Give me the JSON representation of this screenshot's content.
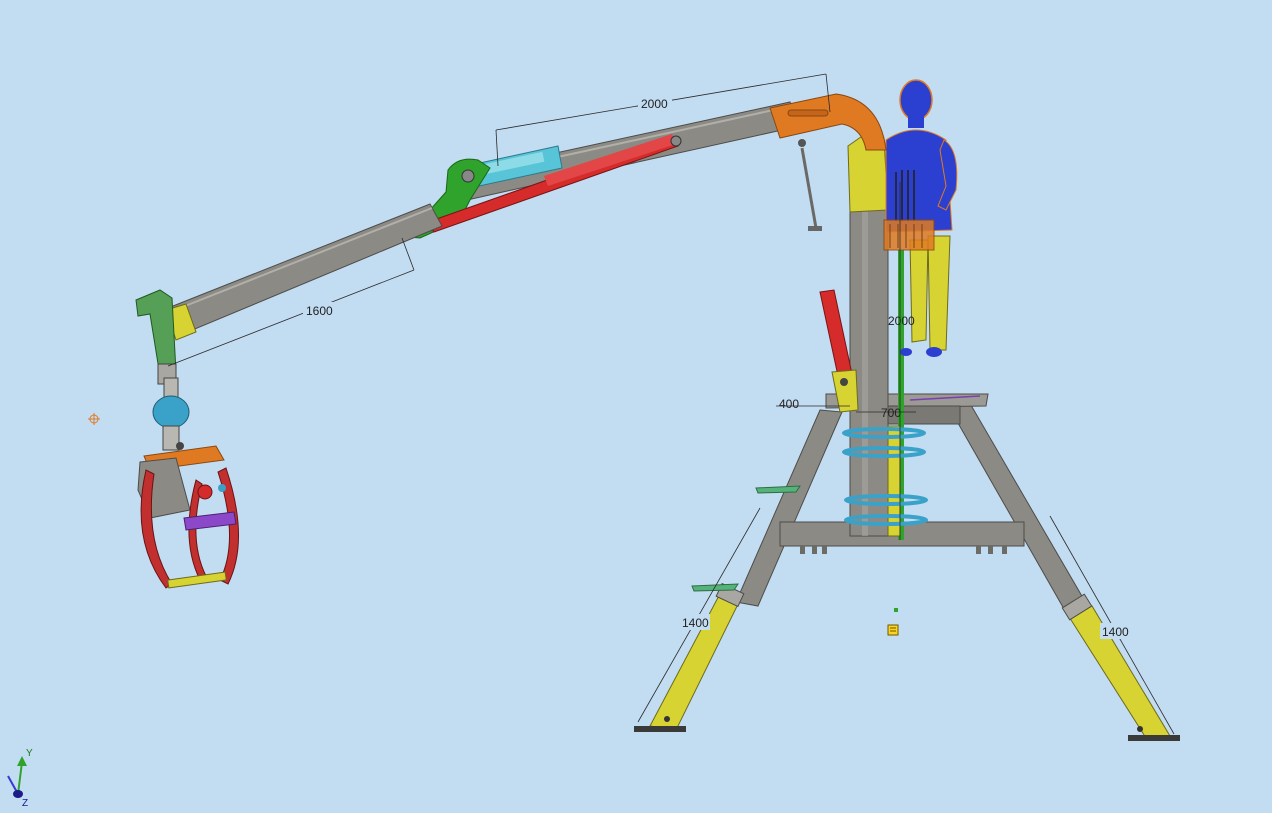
{
  "scene": {
    "background_color": "#c2dcf2",
    "description_hidden": "",
    "colors": {
      "steel": "#8c8a84",
      "steel_dark": "#5d5b57",
      "yellow": "#d6d332",
      "orange": "#e0780e",
      "green": "#2fa32c",
      "red": "#d52b2b",
      "cyan": "#3aa2c9",
      "mannequin_blue": "#2b3fd0",
      "purple": "#8b48c8",
      "teal_plate": "#55b37a"
    }
  },
  "dimensions": {
    "upper_boom": "2000",
    "lower_boom": "1600",
    "mast_height": "2000",
    "offset_left": "400",
    "offset_right": "700",
    "left_leg": "1400",
    "right_leg": "1400"
  },
  "triad": {
    "y": "Y",
    "z": "Z"
  }
}
